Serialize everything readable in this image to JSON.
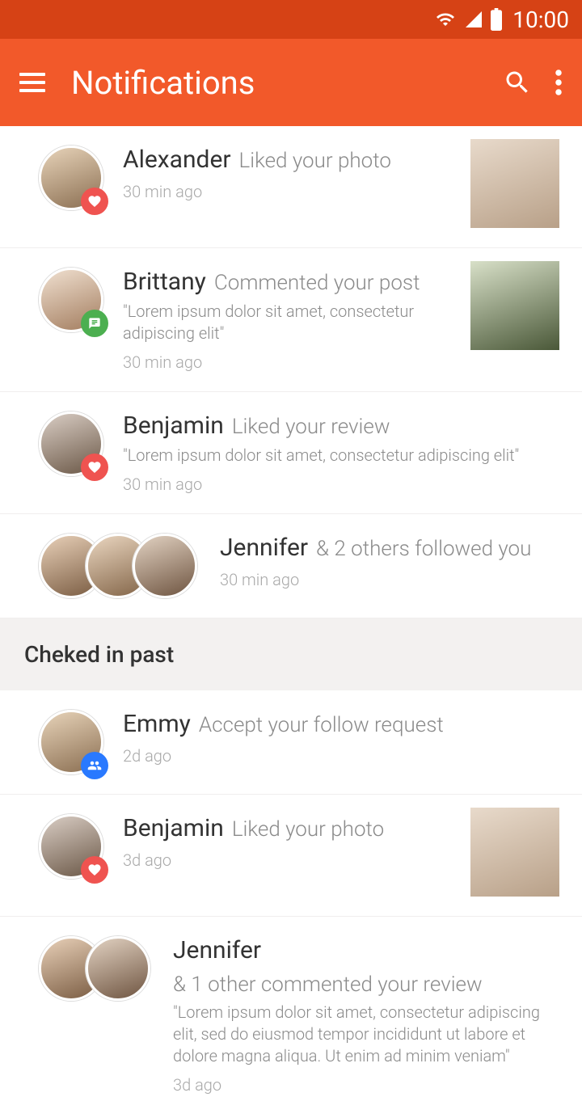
{
  "status": {
    "time": "10:00"
  },
  "header": {
    "title": "Notifications"
  },
  "items_recent": [
    {
      "name": "Alexander",
      "action": "Liked your photo",
      "quote": "",
      "time": "30 min ago",
      "badge": "heart",
      "thumb": true,
      "avatars": 1
    },
    {
      "name": "Brittany",
      "action": "Commented your post",
      "quote": "\"Lorem ipsum dolor sit amet, consectetur adipiscing elit\"",
      "time": "30 min ago",
      "badge": "comment",
      "thumb": true,
      "avatars": 1
    },
    {
      "name": "Benjamin",
      "action": "Liked your review",
      "quote": "\"Lorem ipsum dolor sit amet, consectetur adipiscing elit\"",
      "time": "30 min ago",
      "badge": "heart",
      "thumb": false,
      "avatars": 1
    },
    {
      "name": "Jennifer",
      "action": "& 2 others followed you",
      "quote": "",
      "time": "30 min ago",
      "badge": "",
      "thumb": false,
      "avatars": 3
    }
  ],
  "section": {
    "title": "Cheked in past"
  },
  "items_past": [
    {
      "name": "Emmy",
      "action": "Accept your follow request",
      "quote": "",
      "time": "2d ago",
      "badge": "people",
      "thumb": false,
      "avatars": 1
    },
    {
      "name": "Benjamin",
      "action": "Liked your photo",
      "quote": "",
      "time": "3d ago",
      "badge": "heart",
      "thumb": true,
      "avatars": 1
    },
    {
      "name": "Jennifer",
      "action": "& 1 other commented your review",
      "quote": "\"Lorem ipsum dolor sit amet, consectetur adipiscing elit, sed do eiusmod tempor incididunt ut labore et dolore magna aliqua. Ut enim ad minim veniam\"",
      "time": "3d ago",
      "badge": "",
      "thumb": false,
      "avatars": 2
    }
  ]
}
